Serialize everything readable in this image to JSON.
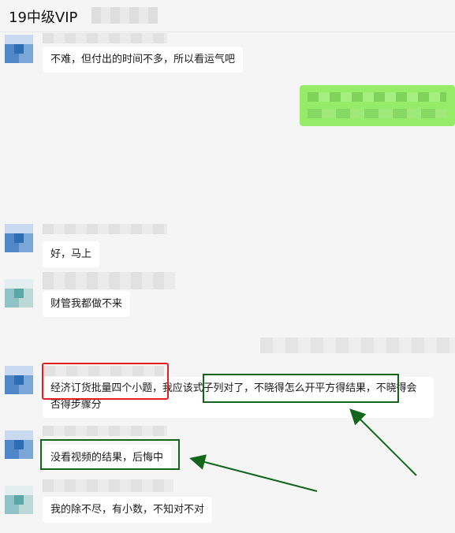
{
  "header": {
    "title": "19中级VIP"
  },
  "messages": [
    {
      "side": "left",
      "text": "不难，但付出的时间不多，所以看运气吧",
      "avatar_icon": "user-avatar-icon"
    },
    {
      "side": "right",
      "text": "",
      "avatar_icon": ""
    },
    {
      "side": "left",
      "text": "好，马上",
      "avatar_icon": "user-avatar-icon"
    },
    {
      "side": "left",
      "text": "财管我都做不来",
      "avatar_icon": "user-avatar-icon"
    },
    {
      "side": "left",
      "text": "经济订货批量四个小题，我应该式子列对了，不晓得怎么开平方得结果，不晓得会否得步骤分",
      "avatar_icon": "user-avatar-icon"
    },
    {
      "side": "left",
      "text": "没看视频的结果，后悔中",
      "avatar_icon": "user-avatar-icon"
    },
    {
      "side": "left",
      "text": "我的除不尽，有小数，不知对不对",
      "avatar_icon": "user-avatar-icon"
    }
  ],
  "annotations": {
    "red_box_color": "#e02020",
    "green_box_color": "#11661b"
  },
  "colors": {
    "background": "#f5f5f5",
    "bubble_other": "#ffffff",
    "bubble_self": "#95ec69"
  }
}
